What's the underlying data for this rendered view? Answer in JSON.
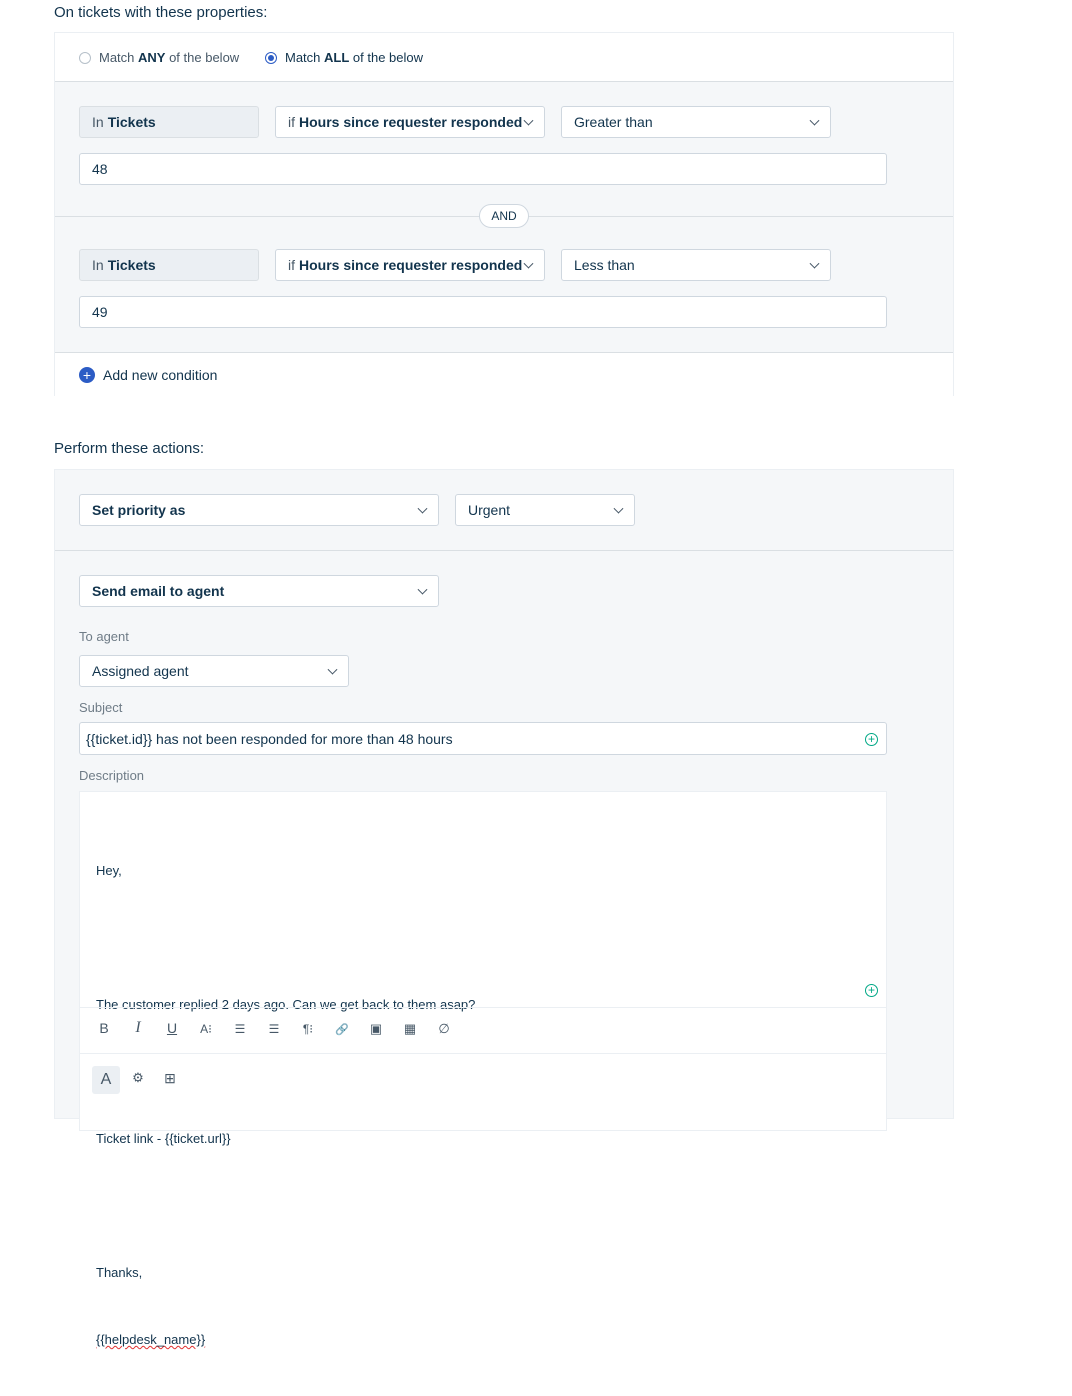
{
  "conditions": {
    "heading": "On tickets with these properties:",
    "match_any": {
      "prefix": "Match ",
      "strong": "ANY",
      "suffix": " of the below"
    },
    "match_all": {
      "prefix": "Match ",
      "strong": "ALL",
      "suffix": " of the below"
    },
    "selected_match": "all",
    "rows": [
      {
        "scope_prefix": "In",
        "scope": "Tickets",
        "field_prefix": "if",
        "field": "Hours since requester responded",
        "operator": "Greater than",
        "value": "48"
      },
      {
        "scope_prefix": "In",
        "scope": "Tickets",
        "field_prefix": "if",
        "field": "Hours since requester responded",
        "operator": "Less than",
        "value": "49"
      }
    ],
    "joiner": "AND",
    "add_condition_label": "Add new condition"
  },
  "actions": {
    "heading": "Perform these actions:",
    "action1": {
      "type": "Set priority as",
      "value": "Urgent"
    },
    "action2": {
      "type": "Send email to agent",
      "to_agent_label": "To agent",
      "to_agent_value": "Assigned agent",
      "subject_label": "Subject",
      "subject_value": "{{ticket.id}} has not been responded for more than 48 hours",
      "description_label": "Description",
      "description_lines": [
        "Hey,",
        "",
        "The customer replied 2 days ago. Can we get back to them asap?",
        "",
        "Ticket link - {{ticket.url}}",
        "",
        "Thanks,",
        "{{helpdesk_name}}"
      ]
    }
  },
  "toolbar": {
    "bold": "B",
    "italic": "I",
    "underline": "U",
    "font_size": "A⁝",
    "ordered_list": "☰",
    "bullet_list": "☰",
    "paragraph": "¶⁝",
    "link": "🔗",
    "image": "▣",
    "table": "▦",
    "clear": "∅"
  },
  "bottom_toolbar": {
    "text": "A",
    "placeholder": "⚙",
    "kb": "⊞"
  },
  "colors": {
    "accent": "#2c5cc5",
    "green": "#00a886",
    "border": "#cfd7df",
    "panel": "#f5f7f9"
  }
}
